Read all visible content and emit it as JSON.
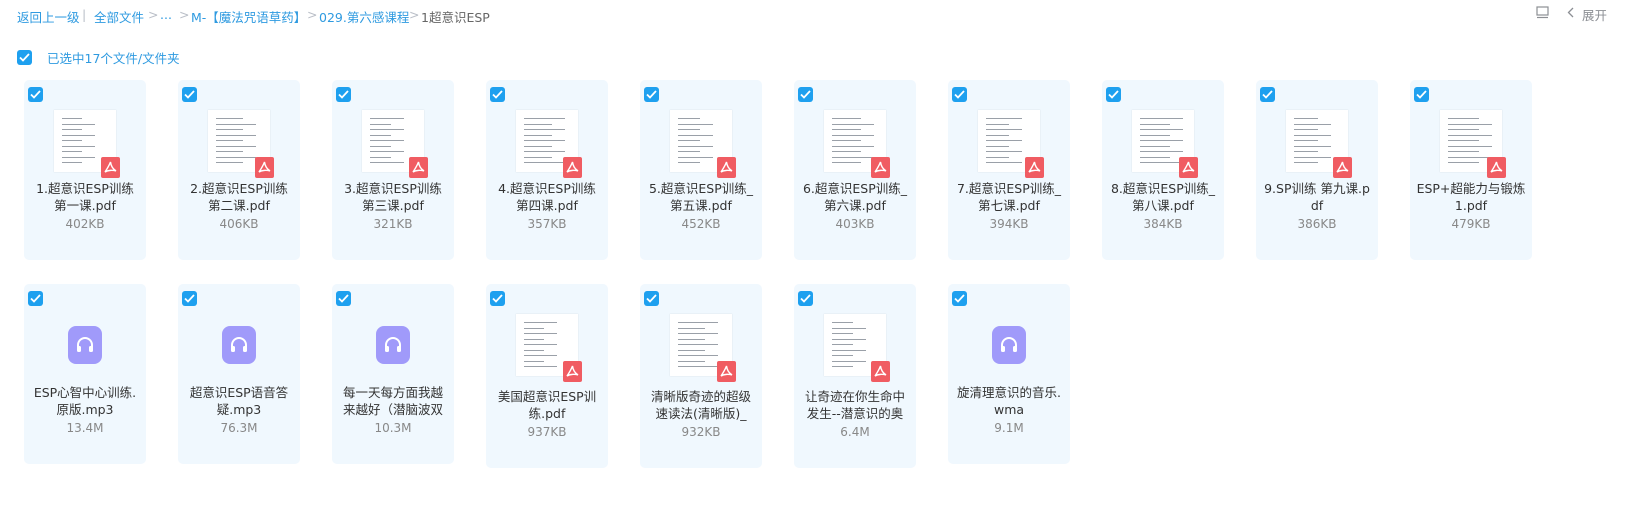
{
  "breadcrumb": {
    "back": "返回上一级",
    "all_files": "全部文件",
    "ellipsis": "...",
    "folder1": "M-【魔法咒语草药】",
    "folder2": "029.第六感课程",
    "current": "1超意识ESP"
  },
  "toolbar": {
    "expand": "展开",
    "layout_icon": "list-layout-icon",
    "chevron": "chevron-left-icon"
  },
  "selection": {
    "label": "已选中17个文件/文件夹"
  },
  "colors": {
    "accent": "#2e9ae0",
    "checkbox": "#1ea0ef",
    "card_bg": "#f0f8fe",
    "pdf_badge": "#f05c62",
    "audio_icon": "#a09afa"
  },
  "files": [
    {
      "name": "1.超意识ESP训练第一课.pdf",
      "size": "402KB",
      "type": "pdf"
    },
    {
      "name": "2.超意识ESP训练第二课.pdf",
      "size": "406KB",
      "type": "pdf"
    },
    {
      "name": "3.超意识ESP训练第三课.pdf",
      "size": "321KB",
      "type": "pdf"
    },
    {
      "name": "4.超意识ESP训练第四课.pdf",
      "size": "357KB",
      "type": "pdf"
    },
    {
      "name": "5.超意识ESP训练_第五课.pdf",
      "size": "452KB",
      "type": "pdf"
    },
    {
      "name": "6.超意识ESP训练_第六课.pdf",
      "size": "403KB",
      "type": "pdf"
    },
    {
      "name": "7.超意识ESP训练_第七课.pdf",
      "size": "394KB",
      "type": "pdf"
    },
    {
      "name": "8.超意识ESP训练_第八课.pdf",
      "size": "384KB",
      "type": "pdf"
    },
    {
      "name": "9.SP训练 第九课.pdf",
      "size": "386KB",
      "type": "pdf"
    },
    {
      "name": "ESP+超能力与锻炼1.pdf",
      "size": "479KB",
      "type": "pdf"
    },
    {
      "name": "ESP心智中心训练.原版.mp3",
      "size": "13.4M",
      "type": "audio"
    },
    {
      "name": "超意识ESP语音答疑.mp3",
      "size": "76.3M",
      "type": "audio"
    },
    {
      "name": "每一天每方面我越来越好（潜脑波双",
      "size": "10.3M",
      "type": "audio"
    },
    {
      "name": "美国超意识ESP训练.pdf",
      "size": "937KB",
      "type": "pdf"
    },
    {
      "name": "清晰版奇迹的超级速读法(清晰版)_",
      "size": "932KB",
      "type": "pdf"
    },
    {
      "name": "让奇迹在你生命中发生--潜意识的奥",
      "size": "6.4M",
      "type": "pdf"
    },
    {
      "name": "旋清理意识的音乐.wma",
      "size": "9.1M",
      "type": "audio"
    }
  ]
}
